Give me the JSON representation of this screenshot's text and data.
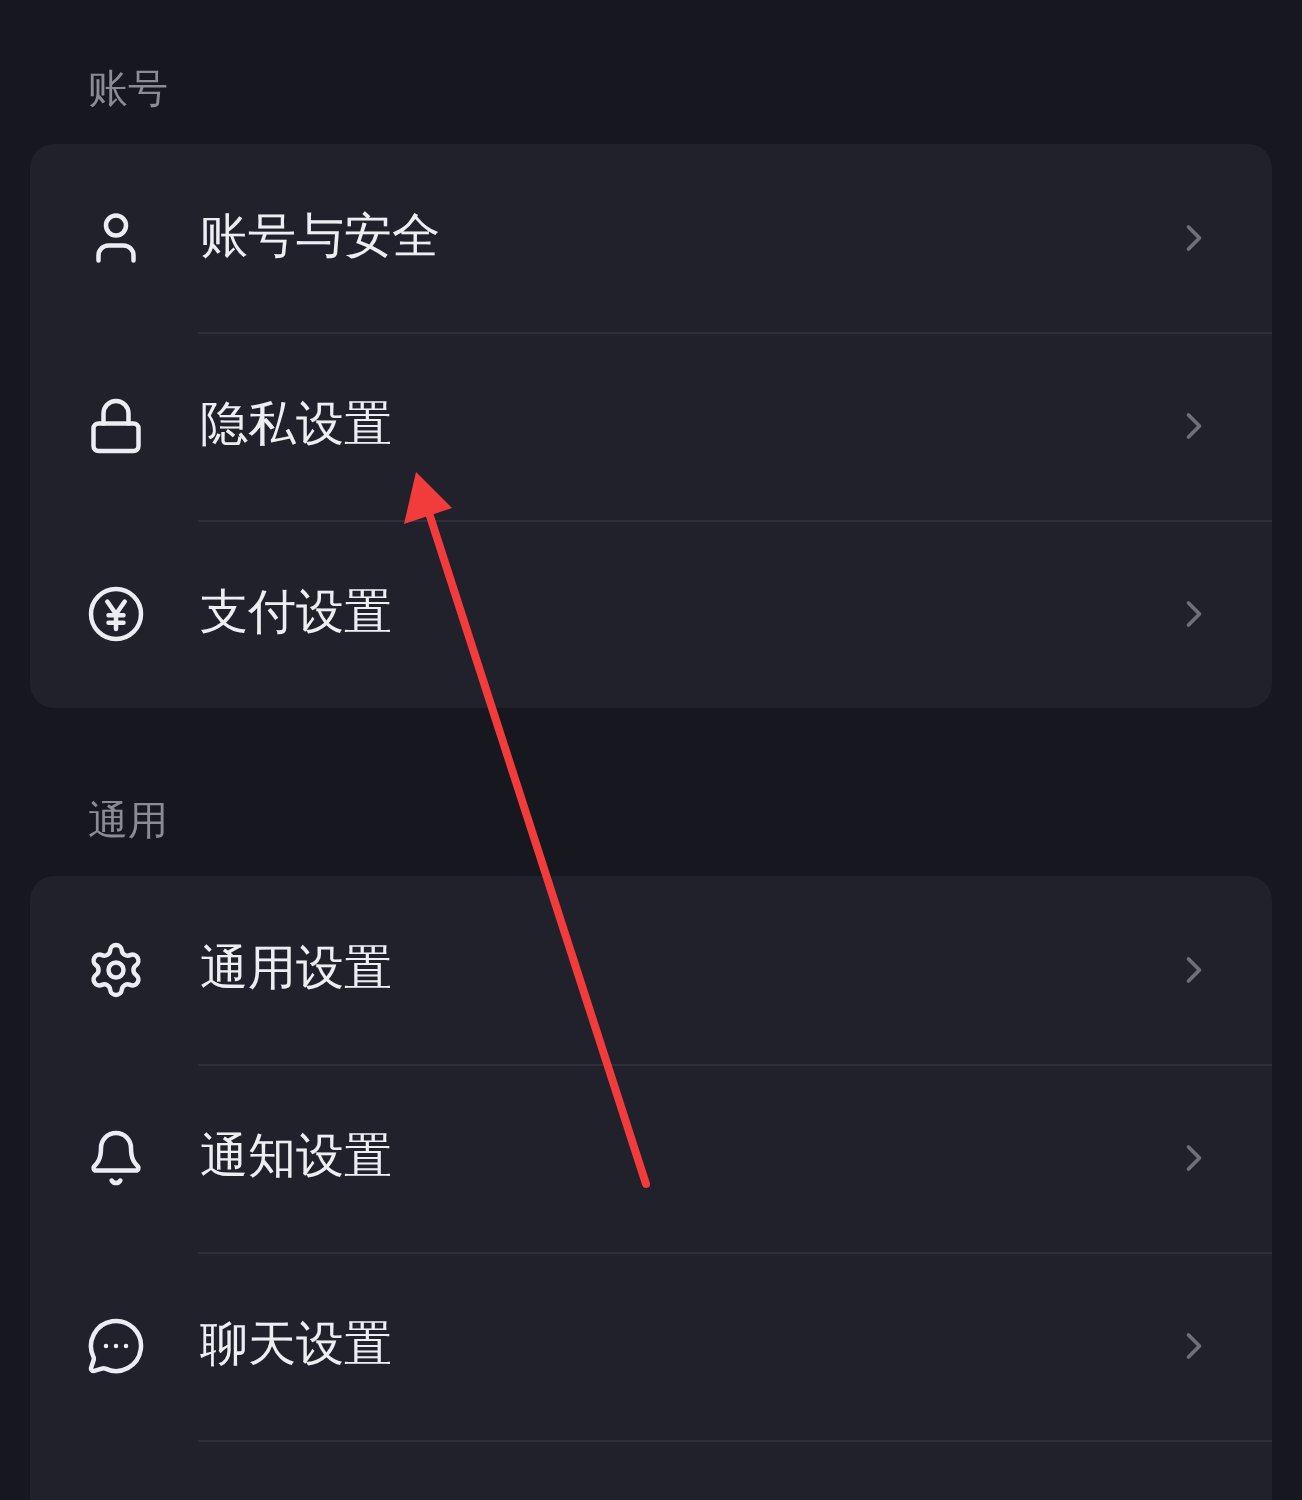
{
  "sections": [
    {
      "title": "账号",
      "items": [
        {
          "label": "账号与安全"
        },
        {
          "label": "隐私设置"
        },
        {
          "label": "支付设置"
        }
      ]
    },
    {
      "title": "通用",
      "items": [
        {
          "label": "通用设置"
        },
        {
          "label": "通知设置"
        },
        {
          "label": "聊天设置"
        }
      ]
    }
  ]
}
